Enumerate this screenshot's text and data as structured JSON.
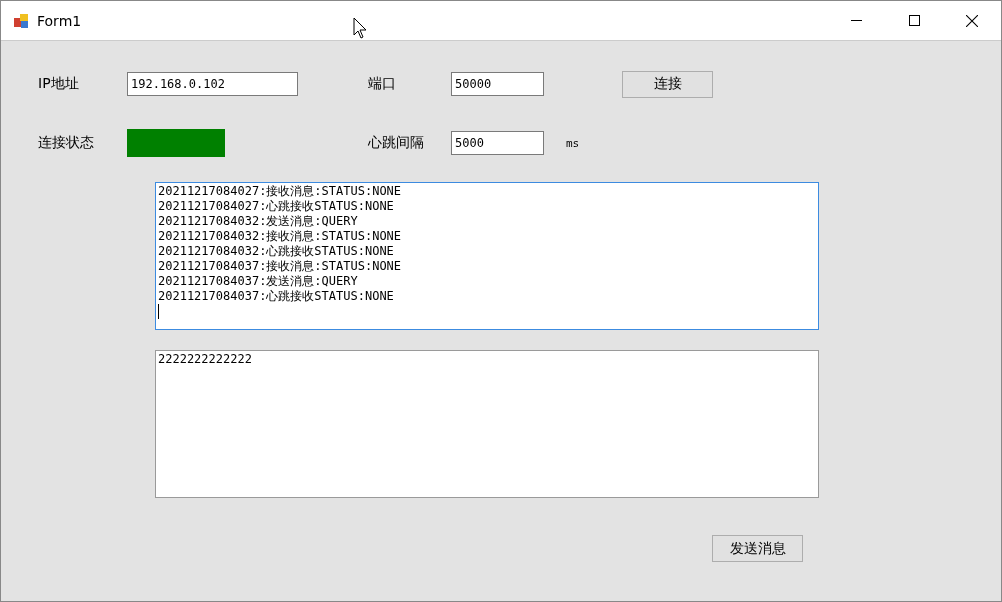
{
  "window": {
    "title": "Form1"
  },
  "ip": {
    "label": "IP地址",
    "value": "192.168.0.102"
  },
  "port": {
    "label": "端口",
    "value": "50000"
  },
  "connect_button": "连接",
  "connection_status": {
    "label": "连接状态",
    "connected": true
  },
  "heartbeat": {
    "label": "心跳间隔",
    "value": "5000",
    "unit": "ms"
  },
  "log": {
    "focused": true,
    "lines": [
      "20211217084027:接收消息:STATUS:NONE",
      "20211217084027:心跳接收STATUS:NONE",
      "20211217084032:发送消息:QUERY",
      "20211217084032:接收消息:STATUS:NONE",
      "20211217084032:心跳接收STATUS:NONE",
      "20211217084037:接收消息:STATUS:NONE",
      "20211217084037:发送消息:QUERY",
      "20211217084037:心跳接收STATUS:NONE"
    ]
  },
  "message": {
    "value": "2222222222222"
  },
  "send_button": "发送消息"
}
